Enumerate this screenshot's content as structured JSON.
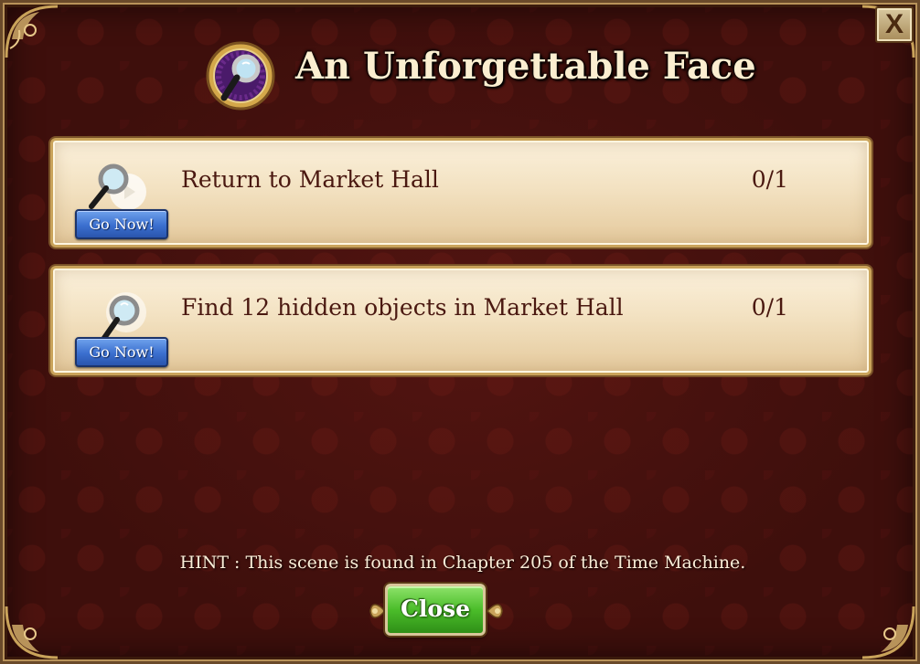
{
  "dialog": {
    "title": "An Unforgettable Face",
    "close_x": "X"
  },
  "tasks": [
    {
      "label": "Return to Market Hall",
      "progress": "0/1",
      "button": "Go Now!"
    },
    {
      "label": "Find 12 hidden objects in Market Hall",
      "progress": "0/1",
      "button": "Go Now!"
    }
  ],
  "hint": "HINT : This scene is found in Chapter 205 of the Time Machine.",
  "footer": {
    "close_label": "Close"
  },
  "icons": {
    "title": "magnifying-glass-medallion",
    "task1": "magnifying-glass-play",
    "task2": "magnifying-glass-sparkle"
  },
  "colors": {
    "background": "#3e0f0c",
    "panel": "#f3e2c2",
    "go_button": "#3b6fcf",
    "close_button": "#4bbd2a",
    "title_text": "#fbeed0"
  }
}
